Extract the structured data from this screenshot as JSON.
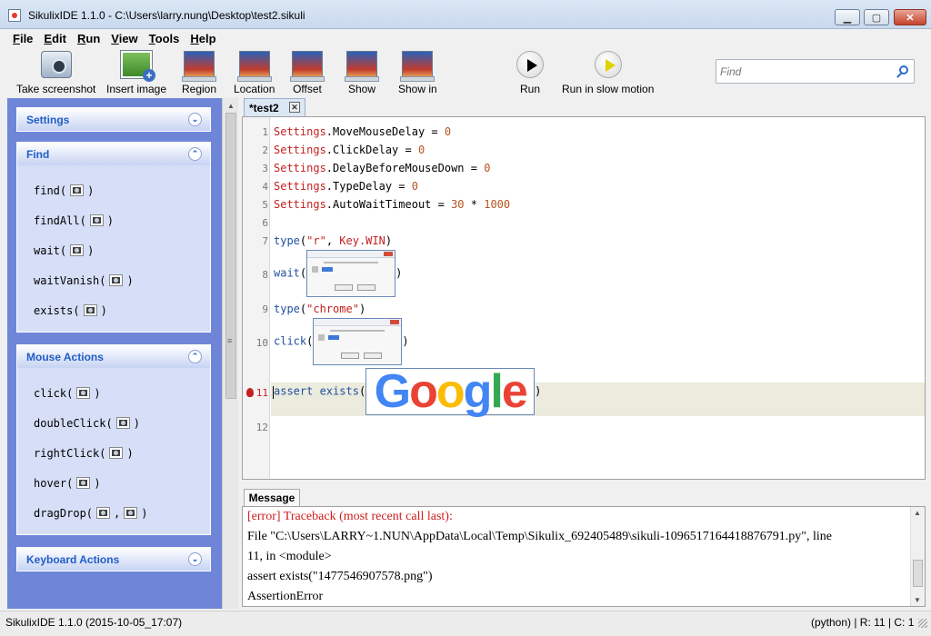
{
  "window": {
    "title": "SikulixIDE 1.1.0 - C:\\Users\\larry.nung\\Desktop\\test2.sikuli"
  },
  "menu": {
    "items": [
      {
        "label": "File",
        "mnemonic": "F",
        "rest": "ile"
      },
      {
        "label": "Edit",
        "mnemonic": "E",
        "rest": "dit"
      },
      {
        "label": "Run",
        "mnemonic": "R",
        "rest": "un"
      },
      {
        "label": "View",
        "mnemonic": "V",
        "rest": "iew"
      },
      {
        "label": "Tools",
        "mnemonic": "T",
        "rest": "ools"
      },
      {
        "label": "Help",
        "mnemonic": "H",
        "rest": "elp"
      }
    ]
  },
  "toolbar": {
    "take_screenshot": "Take screenshot",
    "insert_image": "Insert image",
    "region": "Region",
    "location": "Location",
    "offset": "Offset",
    "show": "Show",
    "show_in": "Show in",
    "run": "Run",
    "run_slow": "Run in slow motion",
    "find_placeholder": "Find"
  },
  "sidebar": {
    "settings": {
      "title": "Settings"
    },
    "find": {
      "title": "Find",
      "commands": [
        {
          "name": "find(",
          "close": ")"
        },
        {
          "name": "findAll(",
          "close": ")"
        },
        {
          "name": "wait(",
          "close": ")"
        },
        {
          "name": "waitVanish(",
          "close": ")"
        },
        {
          "name": "exists(",
          "close": ")"
        }
      ]
    },
    "mouse": {
      "title": "Mouse Actions",
      "commands": [
        {
          "name": "click(",
          "close": ")"
        },
        {
          "name": "doubleClick(",
          "close": ")"
        },
        {
          "name": "rightClick(",
          "close": ")"
        },
        {
          "name": "hover(",
          "close": ")"
        },
        {
          "name": "dragDrop(",
          "sep": ",",
          "close": ")"
        }
      ]
    },
    "keyboard": {
      "title": "Keyboard Actions"
    }
  },
  "editor": {
    "tab_label": "*test2",
    "line_numbers": [
      "1",
      "2",
      "3",
      "4",
      "5",
      "6",
      "7",
      "8",
      "9",
      "10",
      "11",
      "12"
    ],
    "lines": {
      "l1": {
        "obj": "Settings",
        "rest": ".MoveMouseDelay = ",
        "num": "0"
      },
      "l2": {
        "obj": "Settings",
        "rest": ".ClickDelay = ",
        "num": "0"
      },
      "l3": {
        "obj": "Settings",
        "rest": ".DelayBeforeMouseDown = ",
        "num": "0"
      },
      "l4": {
        "obj": "Settings",
        "rest": ".TypeDelay = ",
        "num": "0"
      },
      "l5": {
        "obj": "Settings",
        "rest": ".AutoWaitTimeout = ",
        "num": "30",
        "op": " * ",
        "num2": "1000"
      },
      "l7": {
        "fn": "type",
        "open": "(",
        "str": "\"r\"",
        "sep": ", ",
        "key": "Key.WIN",
        "close": ")"
      },
      "l8": {
        "fn": "wait",
        "open": "(",
        "close": ")"
      },
      "l9": {
        "fn": "type",
        "open": "(",
        "str": "\"chrome\"",
        "close": ")"
      },
      "l10": {
        "fn": "click",
        "open": "(",
        "close": ")"
      },
      "l11": {
        "kw": "assert",
        "fn": " exists",
        "open": "(",
        "close": ")"
      }
    },
    "google_logo": {
      "g1": "G",
      "g2": "o",
      "g3": "o",
      "g4": "g",
      "g5": "l",
      "g6": "e"
    }
  },
  "message": {
    "tab_label": "Message",
    "lines": [
      "[error] Traceback (most recent call last):",
      "File \"C:\\Users\\LARRY~1.NUN\\AppData\\Local\\Temp\\Sikulix_692405489\\sikuli-1096517164418876791.py\", line",
      "11, in <module>",
      "assert exists(\"1477546907578.png\")",
      "AssertionError"
    ]
  },
  "status": {
    "left": "SikulixIDE 1.1.0 (2015-10-05_17:07)",
    "right": "(python) | R: 11 | C: 1"
  },
  "colors": {
    "sidebar_bg": "#6f86d8",
    "panel_title": "#215dc6",
    "error_text": "#d01c1c",
    "current_line": "#ebebde"
  }
}
